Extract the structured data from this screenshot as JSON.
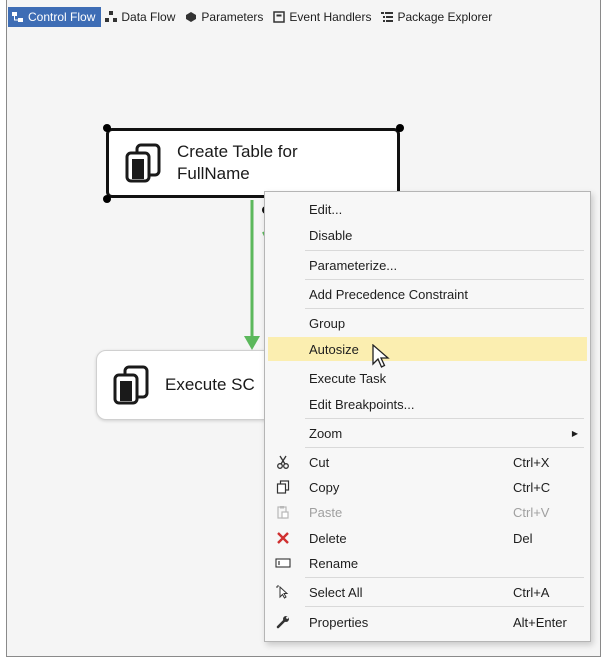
{
  "tabs": [
    {
      "label": "Control Flow",
      "icon": "control-flow-icon",
      "active": true
    },
    {
      "label": "Data Flow",
      "icon": "data-flow-icon",
      "active": false
    },
    {
      "label": "Parameters",
      "icon": "parameters-icon",
      "active": false
    },
    {
      "label": "Event Handlers",
      "icon": "event-handlers-icon",
      "active": false
    },
    {
      "label": "Package Explorer",
      "icon": "package-explorer-icon",
      "active": false
    }
  ],
  "tasks": {
    "task1": {
      "line1": "Create Table for",
      "line2": "FullName"
    },
    "task2": {
      "label": "Execute SC"
    }
  },
  "menu": {
    "items": [
      {
        "label": "Edit..."
      },
      {
        "label": "Disable"
      },
      {
        "label": "Parameterize..."
      },
      {
        "label": "Add Precedence Constraint"
      },
      {
        "label": "Group"
      },
      {
        "label": "Autosize",
        "highlighted": true
      },
      {
        "label": "Execute Task"
      },
      {
        "label": "Edit Breakpoints..."
      },
      {
        "label": "Zoom",
        "submenu": true
      },
      {
        "label": "Cut",
        "shortcut": "Ctrl+X",
        "icon": "scissors-icon"
      },
      {
        "label": "Copy",
        "shortcut": "Ctrl+C",
        "icon": "copy-icon"
      },
      {
        "label": "Paste",
        "shortcut": "Ctrl+V",
        "icon": "paste-icon",
        "disabled": true
      },
      {
        "label": "Delete",
        "shortcut": "Del",
        "icon": "delete-icon"
      },
      {
        "label": "Rename",
        "icon": "rename-icon"
      },
      {
        "label": "Select All",
        "shortcut": "Ctrl+A",
        "icon": "select-all-icon"
      },
      {
        "label": "Properties",
        "shortcut": "Alt+Enter",
        "icon": "wrench-icon"
      }
    ]
  },
  "colors": {
    "active_tab": "#3e6db5",
    "highlight": "#fbeeb0",
    "connector": "#5cb85c",
    "delete_icon": "#d03030"
  }
}
